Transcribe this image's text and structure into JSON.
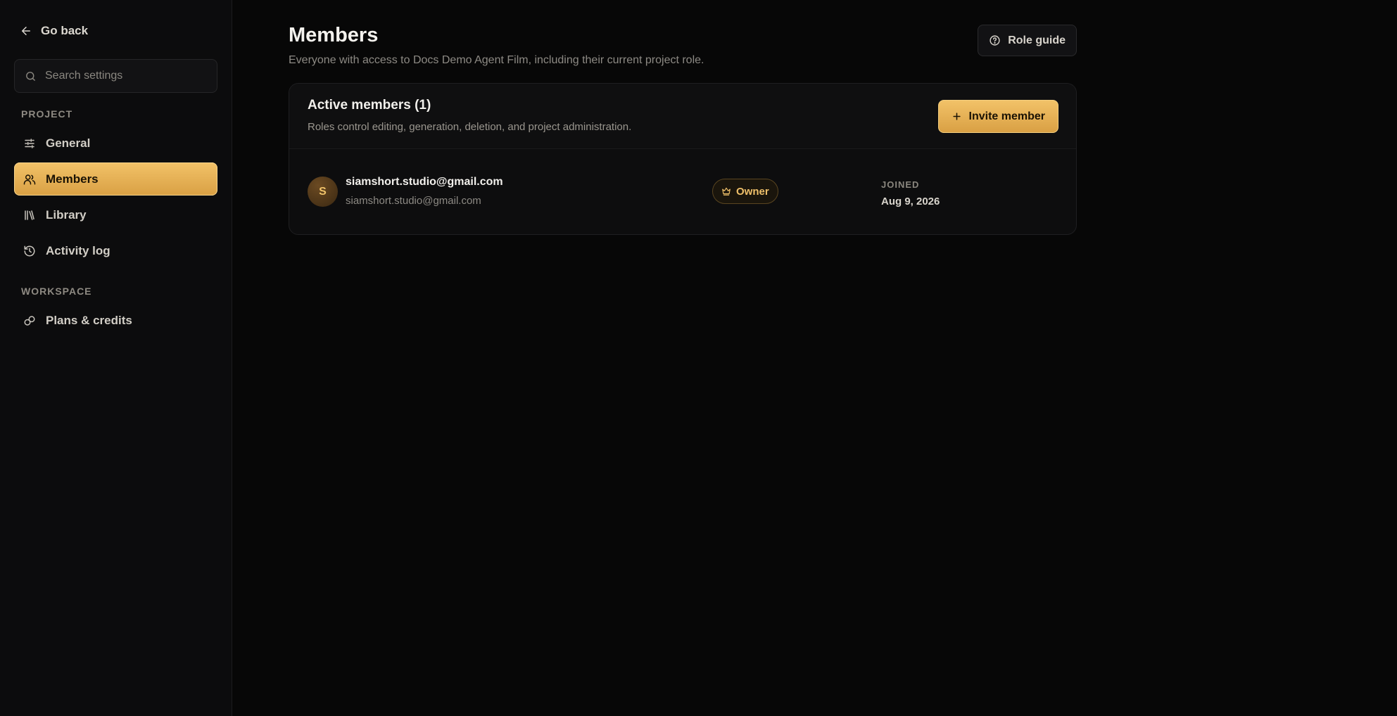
{
  "sidebar": {
    "go_back_label": "Go back",
    "search_placeholder": "Search settings",
    "sections": {
      "project": {
        "label": "PROJECT",
        "items": [
          {
            "label": "General",
            "icon": "sliders-icon"
          },
          {
            "label": "Members",
            "icon": "users-icon",
            "active": true
          },
          {
            "label": "Library",
            "icon": "books-icon"
          },
          {
            "label": "Activity log",
            "icon": "history-icon"
          }
        ]
      },
      "workspace": {
        "label": "WORKSPACE",
        "items": [
          {
            "label": "Plans & credits",
            "icon": "coins-icon"
          }
        ]
      }
    }
  },
  "header": {
    "title": "Members",
    "subtitle": "Everyone with access to Docs Demo Agent Film, including their current project role.",
    "role_guide_label": "Role guide"
  },
  "members_card": {
    "title": "Active members (1)",
    "description": "Roles control editing, generation, deletion, and project administration.",
    "invite_label": "Invite member",
    "members": [
      {
        "initial": "S",
        "name": "siamshort.studio@gmail.com",
        "email": "siamshort.studio@gmail.com",
        "role": "Owner",
        "joined_label": "JOINED",
        "joined_date": "Aug 9, 2026"
      }
    ]
  },
  "colors": {
    "accent": "#f2c268",
    "background": "#070707",
    "sidebar": "#0c0c0d"
  }
}
